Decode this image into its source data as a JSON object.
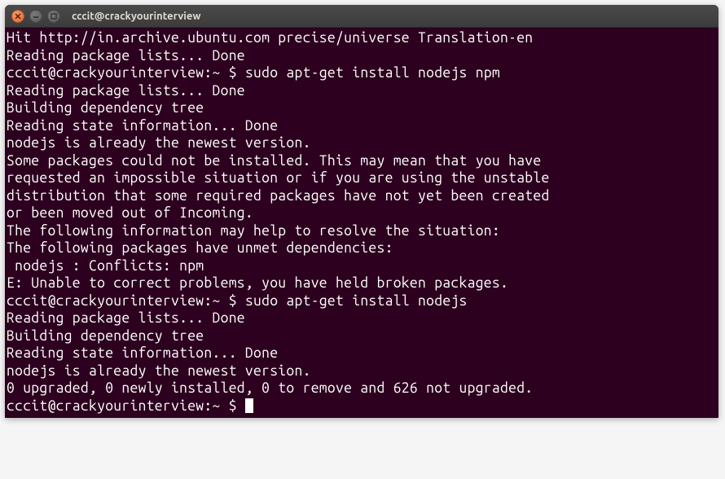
{
  "titlebar": {
    "title": "cccit@crackyourinterview"
  },
  "prompt": {
    "user_host": "cccit@crackyourinterview",
    "path": "~",
    "dollar": "$"
  },
  "lines": {
    "l01": "Hit http://in.archive.ubuntu.com precise/universe Translation-en",
    "l02": "Reading package lists... Done",
    "cmd1": "sudo apt-get install nodejs npm",
    "l04": "Reading package lists... Done",
    "l05": "Building dependency tree",
    "l06": "Reading state information... Done",
    "l07": "nodejs is already the newest version.",
    "l08": "Some packages could not be installed. This may mean that you have",
    "l09": "requested an impossible situation or if you are using the unstable",
    "l10": "distribution that some required packages have not yet been created",
    "l11": "or been moved out of Incoming.",
    "l12": "The following information may help to resolve the situation:",
    "l13": "",
    "l14": "The following packages have unmet dependencies:",
    "l15": " nodejs : Conflicts: npm",
    "l16": "E: Unable to correct problems, you have held broken packages.",
    "cmd2": "sudo apt-get install nodejs",
    "l18": "Reading package lists... Done",
    "l19": "Building dependency tree",
    "l20": "Reading state information... Done",
    "l21": "nodejs is already the newest version.",
    "l22": "0 upgraded, 0 newly installed, 0 to remove and 626 not upgraded."
  }
}
